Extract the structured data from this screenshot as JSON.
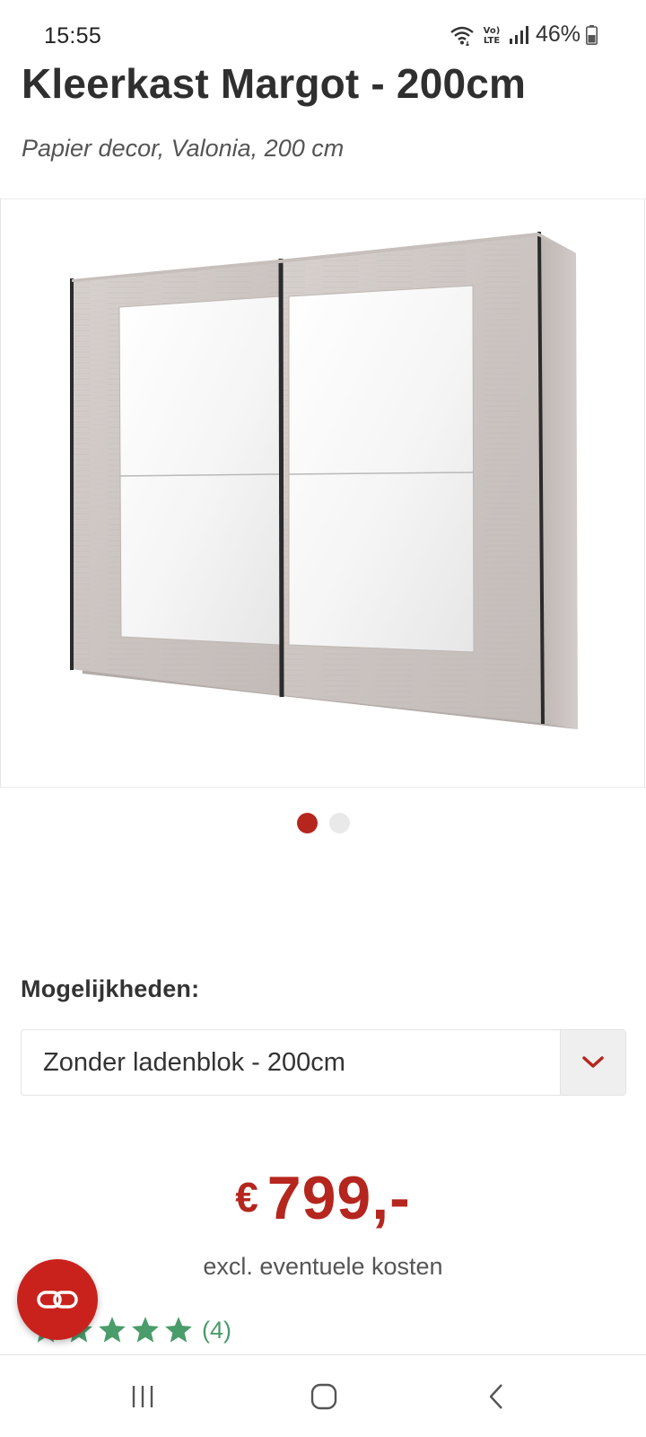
{
  "status_bar": {
    "time": "15:55",
    "battery": "46%",
    "icons": [
      "wifi-icon",
      "volte-lte-icon",
      "signal-icon",
      "battery-icon"
    ]
  },
  "product": {
    "title": "Kleerkast Margot - 200cm",
    "subtitle": "Papier decor, Valonia, 200 cm"
  },
  "gallery": {
    "image": "wardrobe-product-image",
    "dots": 2,
    "active_dot": 0
  },
  "options": {
    "label": "Mogelijkheden:",
    "selected": "Zonder ladenblok - 200cm",
    "arrow_icon": "chevron-down-icon"
  },
  "pricing": {
    "currency": "€",
    "amount": "799,-",
    "note": "excl. eventuele kosten"
  },
  "rating": {
    "stars": 5,
    "count": "(4)"
  },
  "fab": {
    "icon": "link-icon"
  },
  "nav_bar": {
    "buttons": [
      "recents-icon",
      "home-icon",
      "back-icon"
    ]
  },
  "colors": {
    "accent": "#b5261e",
    "rating": "#4a9c6a"
  }
}
